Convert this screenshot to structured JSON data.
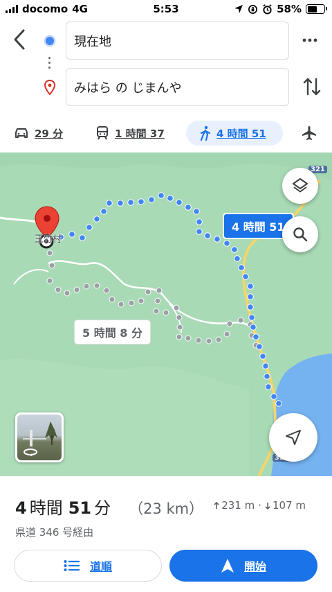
{
  "status": {
    "carrier": "docomo",
    "network": "4G",
    "time": "5:53",
    "battery": "58%"
  },
  "header": {
    "origin": "現在地",
    "destination": "みはら の じまんや"
  },
  "modes": [
    {
      "name": "car",
      "label": "29 分"
    },
    {
      "name": "train",
      "label": "1 時間 37"
    },
    {
      "name": "walk",
      "label": "4 時間 51"
    },
    {
      "name": "plane",
      "label": ""
    }
  ],
  "map": {
    "place_label": "王竹村",
    "route_main": "4 時間 51",
    "route_alt": "5 時間 8 分",
    "road_321_top": "321",
    "road_321_bottom": "321"
  },
  "sheet": {
    "hours": "4",
    "hours_unit": "時間",
    "minutes": "51",
    "minutes_unit": "分",
    "distance": "（23 km）",
    "ascent": "231 m",
    "separator": "·",
    "descent": "107 m",
    "via": "県道 346 号経由",
    "steps_label": "道順",
    "start_label": "開始"
  },
  "colors": {
    "accent": "#1a73e8",
    "route_dots": "#4285f4",
    "alt_route_dots": "#9aa0a6",
    "map_green": "#a8dab5",
    "sea": "#75b2f0"
  }
}
